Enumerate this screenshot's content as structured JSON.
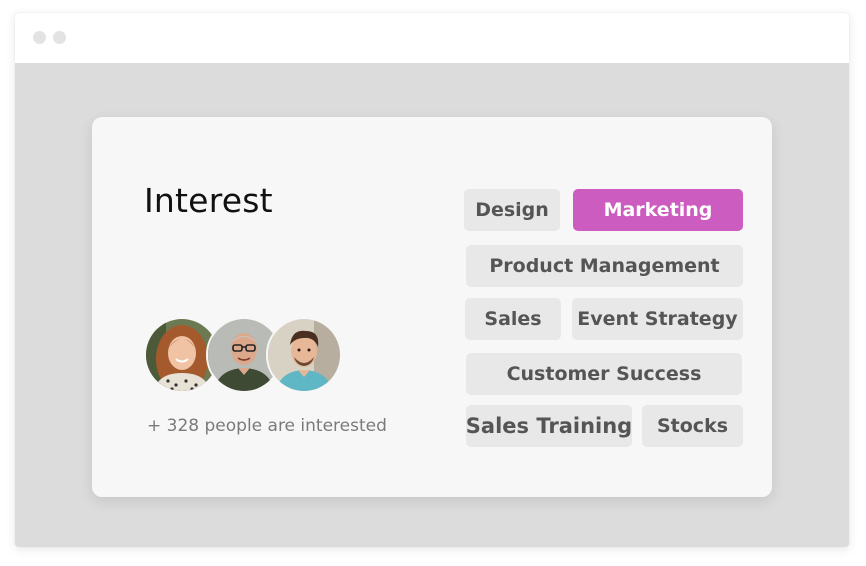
{
  "card": {
    "title": "Interest",
    "interested_text": "+ 328 people are interested"
  },
  "avatars": [
    {
      "name": "woman-avatar"
    },
    {
      "name": "man-glasses-avatar"
    },
    {
      "name": "man-avatar"
    }
  ],
  "tags": [
    {
      "label": "Design",
      "selected": false
    },
    {
      "label": "Marketing",
      "selected": true
    },
    {
      "label": "Product Management",
      "selected": false
    },
    {
      "label": "Sales",
      "selected": false
    },
    {
      "label": "Event Strategy",
      "selected": false
    },
    {
      "label": "Customer Success",
      "selected": false
    },
    {
      "label": "Sales Training",
      "selected": false
    },
    {
      "label": "Stocks",
      "selected": false
    }
  ],
  "colors": {
    "accent": "#cc5cbf",
    "tag_bg": "#e8e8e8",
    "tag_text": "#555555",
    "card_bg": "#f7f7f7",
    "window_bg": "#dcdcdc"
  }
}
